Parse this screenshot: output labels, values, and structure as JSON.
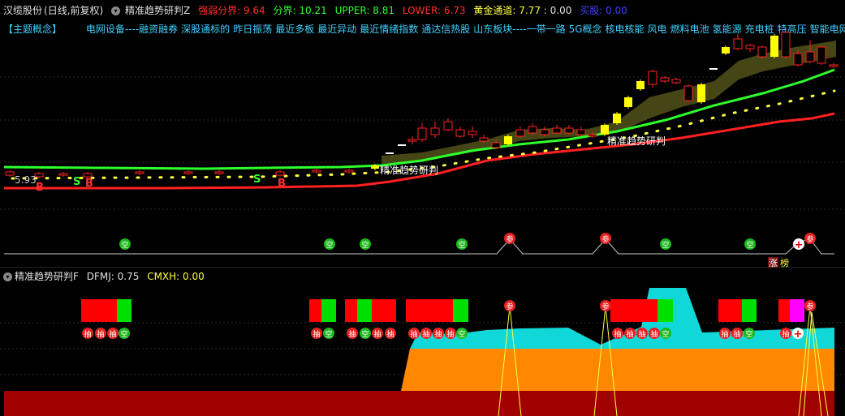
{
  "header": {
    "stock_name": "汉缆股份",
    "mode": "(日线,前复权)",
    "indicator_name": "精准趋势研判Z",
    "strong_weak_label": "强弱分界:",
    "strong_weak_value": "9.64",
    "divide_label": "分界:",
    "divide_value": "10.21",
    "upper_label": "UPPER:",
    "upper_value": "8.81",
    "lower_label": "LOWER:",
    "lower_value": "6.73",
    "gold_label": "黄金通道:",
    "gold_value": "7.77",
    "gold_extra": ": 0.00",
    "buy_label": "买股:",
    "buy_value": "0.00"
  },
  "concepts": {
    "tag": "【主题概念】",
    "items": [
      "电网设备----融资融券",
      "深股通标的",
      "昨日振荡",
      "最近多板",
      "最近异动",
      "最近情绪指数",
      "通达信热股",
      "山东板块----一带一路",
      "5G概念",
      "核电核能",
      "风电",
      "燃料电池",
      "氢能源",
      "充电桩",
      "特高压",
      "智能电网"
    ]
  },
  "main_chart": {
    "price_label": "5.93",
    "signal_label_1": "精准趋势研判",
    "signal_label_2": "精准趋势研判",
    "markers": {
      "b": "B",
      "s": "S"
    },
    "colors": {
      "upper": "#ff2020",
      "ema": "#2cff2c",
      "band": "#5a5a1e",
      "dots": "#ffff40",
      "up_candle": "#ff2020",
      "down_candle": "#ffff00"
    }
  },
  "signal_strip": {
    "kong": "空",
    "can": "参",
    "plus": "+",
    "zhang": "涨",
    "bang": "榜"
  },
  "lower_panel": {
    "indicator_name": "精准趋势研判F",
    "dfmj_label": "DFMJ:",
    "dfmj_value": "0.75",
    "cmxh_label": "CMXH:",
    "cmxh_value": "0.00",
    "badges": {
      "chou": "抽",
      "kong": "空",
      "can": "参",
      "plus": "+"
    },
    "colors": {
      "red": "#ff0000",
      "green": "#00e000",
      "cyan": "#00d8d8",
      "orange": "#ff8800",
      "dark_red": "#a00000",
      "magenta": "#ff00ff"
    }
  }
}
